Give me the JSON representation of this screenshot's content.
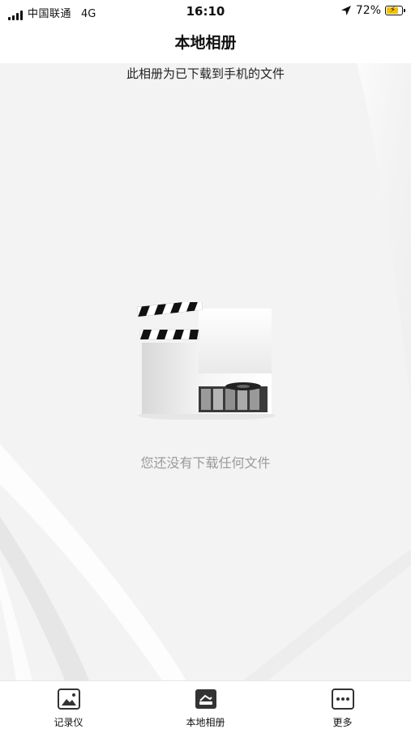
{
  "status_bar": {
    "carrier": "中国联通",
    "network": "4G",
    "time": "16:10",
    "battery": "72%"
  },
  "nav": {
    "title": "本地相册"
  },
  "main": {
    "subtitle": "此相册为已下载到手机的文件",
    "empty_message": "您还没有下载任何文件",
    "illustration_icon": "clapperboard-film-reel"
  },
  "tabs": [
    {
      "label": "记录仪",
      "icon": "picture-icon"
    },
    {
      "label": "本地相册",
      "icon": "local-album-icon",
      "active": true
    },
    {
      "label": "更多",
      "icon": "more-dots-icon"
    }
  ],
  "colors": {
    "battery_fill": "#f2c200",
    "empty_text": "#9a9a9a"
  }
}
